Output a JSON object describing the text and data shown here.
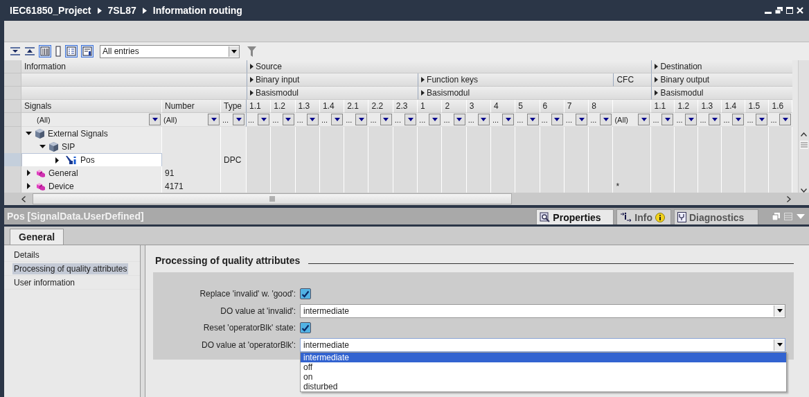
{
  "window": {
    "breadcrumb": [
      "IEC61850_Project",
      "7SL87",
      "Information routing"
    ]
  },
  "toolbar": {
    "view_filter": "All entries"
  },
  "table": {
    "info_header": "Information",
    "info_columns": [
      {
        "label": "Signals",
        "filter": "(All)"
      },
      {
        "label": "Number",
        "filter": "(All)"
      },
      {
        "label": "Type",
        "filter": "..."
      }
    ],
    "sections": [
      {
        "label": "Source",
        "groups": [
          {
            "kind": "matrix",
            "label": "Binary input",
            "module": "Basismodul",
            "columns": [
              {
                "label": "1.1",
                "filter": "..."
              },
              {
                "label": "1.2",
                "filter": "..."
              },
              {
                "label": "1.3",
                "filter": "..."
              },
              {
                "label": "1.4",
                "filter": "..."
              },
              {
                "label": "2.1",
                "filter": "..."
              },
              {
                "label": "2.2",
                "filter": "..."
              },
              {
                "label": "2.3",
                "filter": "..."
              }
            ]
          },
          {
            "kind": "matrix",
            "label": "Function keys",
            "module": "Basismodul",
            "columns": [
              {
                "label": "1",
                "filter": "..."
              },
              {
                "label": "2",
                "filter": "..."
              },
              {
                "label": "3",
                "filter": "..."
              },
              {
                "label": "4",
                "filter": "..."
              },
              {
                "label": "5",
                "filter": "..."
              },
              {
                "label": "6",
                "filter": "..."
              },
              {
                "label": "7",
                "filter": "..."
              },
              {
                "label": "8",
                "filter": "..."
              }
            ]
          },
          {
            "kind": "cfc",
            "label": "CFC",
            "columns": [
              {
                "filter": "(All)"
              }
            ]
          }
        ]
      },
      {
        "label": "Destination",
        "groups": [
          {
            "kind": "matrix",
            "label": "Binary output",
            "module": "Basismodul",
            "columns": [
              {
                "label": "1.1",
                "filter": "..."
              },
              {
                "label": "1.2",
                "filter": "..."
              },
              {
                "label": "1.3",
                "filter": "..."
              },
              {
                "label": "1.4",
                "filter": "..."
              },
              {
                "label": "1.5",
                "filter": "..."
              },
              {
                "label": "1.6",
                "filter": "..."
              }
            ]
          }
        ]
      }
    ],
    "rows": [
      {
        "kind": "folder",
        "label": "External Signals",
        "expanded": true,
        "selected": false,
        "children": [
          {
            "kind": "folder",
            "label": "SIP",
            "expanded": true,
            "selected": false,
            "children": [
              {
                "kind": "signal",
                "label": "Pos",
                "type": "DPC",
                "expanded": false,
                "selected": true
              }
            ]
          }
        ]
      },
      {
        "kind": "group",
        "label": "General",
        "number": "91",
        "expanded": false,
        "selected": false
      },
      {
        "kind": "group",
        "label": "Device",
        "number": "4171",
        "cfc": "*",
        "expanded": false,
        "selected": false
      }
    ]
  },
  "inspector": {
    "title": "Pos [SignalData.UserDefined]",
    "tabs": [
      {
        "kind": "properties",
        "label": "Properties",
        "selected": true
      },
      {
        "kind": "info",
        "label": "Info",
        "selected": false
      },
      {
        "kind": "diagnostics",
        "label": "Diagnostics",
        "selected": false
      }
    ],
    "section_tabs": [
      {
        "label": "General",
        "selected": true
      }
    ],
    "nav": [
      {
        "label": "Details",
        "selected": false
      },
      {
        "label": "Processing of quality attributes",
        "selected": true
      },
      {
        "label": "User information",
        "selected": false
      }
    ],
    "section_title": "Processing of quality attributes",
    "fields": [
      {
        "kind": "checkbox",
        "label": "Replace 'invalid' w. 'good':",
        "checked": true
      },
      {
        "kind": "dropdown",
        "label": "DO value at 'invalid':",
        "value": "intermediate",
        "expanded": false
      },
      {
        "kind": "checkbox",
        "label": "Reset 'operatorBlk' state:",
        "checked": true
      },
      {
        "kind": "dropdown",
        "label": "DO value at 'operatorBlk':",
        "value": "intermediate",
        "expanded": true,
        "options": [
          {
            "label": "intermediate",
            "selected": true
          },
          {
            "label": "off",
            "selected": false
          },
          {
            "label": "on",
            "selected": false
          },
          {
            "label": "disturbed",
            "selected": false
          }
        ]
      }
    ]
  }
}
